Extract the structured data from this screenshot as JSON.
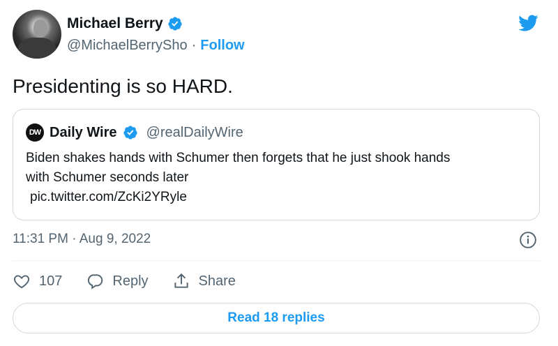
{
  "author": {
    "display_name": "Michael Berry",
    "handle": "@MichaelBerrySho",
    "separator": "·",
    "follow_label": "Follow"
  },
  "tweet": {
    "text": "Presidenting is so HARD.",
    "timestamp": "11:31 PM · Aug 9, 2022"
  },
  "quoted_tweet": {
    "logo_text": "DW",
    "display_name": "Daily Wire",
    "handle": "@realDailyWire",
    "line1": "Biden shakes hands with Schumer then forgets that he just shook hands",
    "line2": "with Schumer seconds later",
    "link": "pic.twitter.com/ZcKi2YRyle"
  },
  "actions": {
    "like_count": "107",
    "reply_label": "Reply",
    "share_label": "Share"
  },
  "read_replies_label": "Read 18 replies",
  "icons": {
    "verified": "verified-badge-icon",
    "brand": "twitter-bird-icon",
    "info": "info-icon",
    "like": "heart-icon",
    "reply": "speech-bubble-icon",
    "share": "share-upload-icon"
  },
  "colors": {
    "accent": "#1d9bf0",
    "text": "#0f1419",
    "muted": "#536471",
    "border": "#cfd9de"
  }
}
